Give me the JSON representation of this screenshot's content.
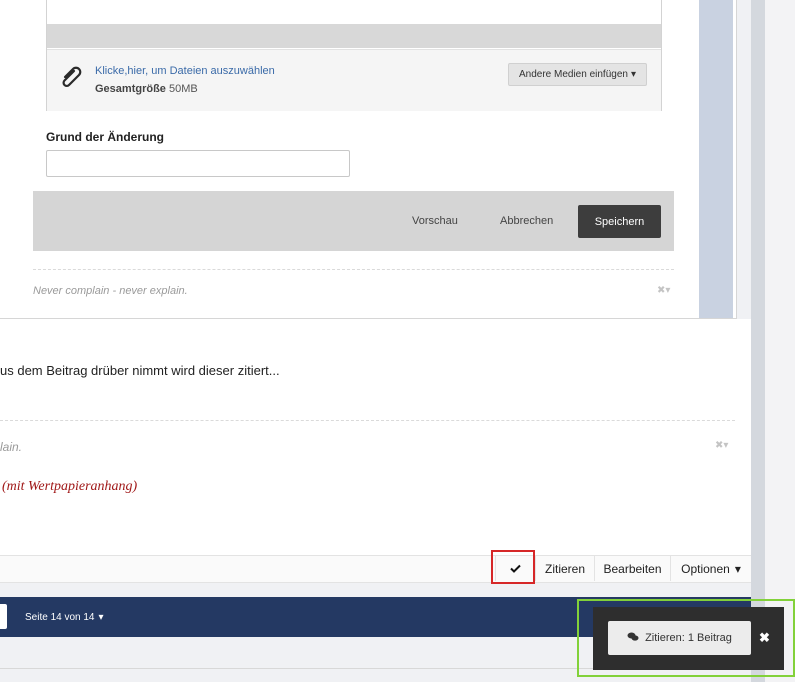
{
  "editor": {
    "attach_link": "Klicke,hier, um Dateien auszuwählen",
    "attach_size_label": "Gesamtgröße",
    "attach_size_value": "50MB",
    "media_button": "Andere Medien einfügen",
    "reason_label": "Grund der Änderung",
    "reason_value": "",
    "preview": "Vorschau",
    "cancel": "Abbrechen",
    "save": "Speichern",
    "signature": "Never complain - never explain."
  },
  "post": {
    "text": "us dem Beitrag drüber nimmt wird dieser zitiert...",
    "signature_tail": "lain.",
    "signature_red": "(mit Wertpapieranhang)",
    "toolbar": {
      "quote": "Zitieren",
      "edit": "Bearbeiten",
      "options": "Optionen"
    }
  },
  "pagination": {
    "label": "Seite 14 von 14"
  },
  "notification": {
    "label": "Zitieren: 1 Beitrag"
  },
  "colors": {
    "highlight_red": "#d62728",
    "highlight_green": "#82d13a",
    "pagination_bar": "#243963",
    "save_button": "#3d3d3d"
  },
  "icons": {
    "attach": "paperclip-icon",
    "selected": "checkmark-icon",
    "notification": "chat-bubbles-icon",
    "close": "close-icon"
  }
}
